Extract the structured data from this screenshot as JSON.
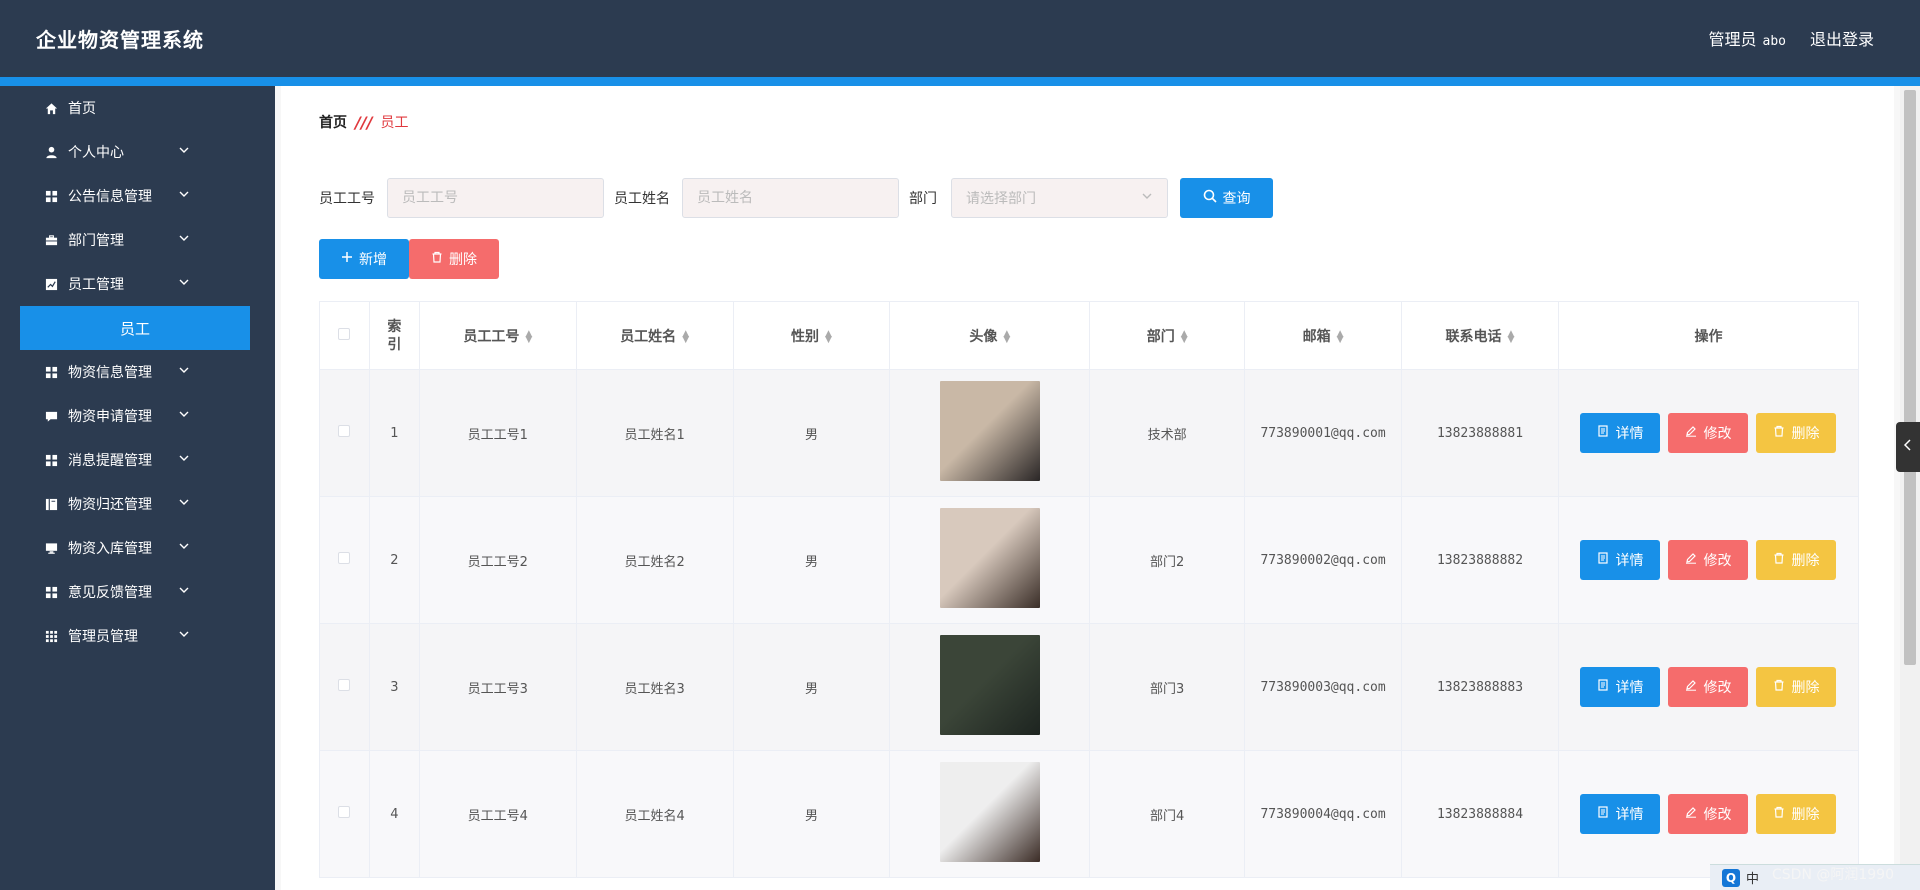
{
  "header": {
    "app_title": "企业物资管理系统",
    "admin_label": "管理员",
    "admin_username": "abo",
    "logout_label": "退出登录"
  },
  "sidebar": {
    "items": [
      {
        "label": "首页",
        "icon": "home-icon",
        "has_children": false
      },
      {
        "label": "个人中心",
        "icon": "user-icon",
        "has_children": true
      },
      {
        "label": "公告信息管理",
        "icon": "grid-icon",
        "has_children": true
      },
      {
        "label": "部门管理",
        "icon": "briefcase-icon",
        "has_children": true
      },
      {
        "label": "员工管理",
        "icon": "chart-icon",
        "has_children": true
      },
      {
        "label": "物资信息管理",
        "icon": "grid-icon",
        "has_children": true
      },
      {
        "label": "物资申请管理",
        "icon": "comment-icon",
        "has_children": true
      },
      {
        "label": "消息提醒管理",
        "icon": "grid-icon",
        "has_children": true
      },
      {
        "label": "物资归还管理",
        "icon": "book-icon",
        "has_children": true
      },
      {
        "label": "物资入库管理",
        "icon": "monitor-icon",
        "has_children": true
      },
      {
        "label": "意见反馈管理",
        "icon": "grid-icon",
        "has_children": true
      },
      {
        "label": "管理员管理",
        "icon": "apps-icon",
        "has_children": true
      }
    ],
    "active_submenu": "员工"
  },
  "breadcrumb": {
    "home": "首页",
    "separator": "///",
    "current": "员工"
  },
  "search": {
    "emp_no_label": "员工工号",
    "emp_no_placeholder": "员工工号",
    "emp_name_label": "员工姓名",
    "emp_name_placeholder": "员工姓名",
    "dept_label": "部门",
    "dept_placeholder": "请选择部门",
    "query_label": "查询"
  },
  "actions": {
    "add_label": "新增",
    "delete_label": "删除"
  },
  "table": {
    "columns": [
      "索引",
      "员工工号",
      "员工姓名",
      "性别",
      "头像",
      "部门",
      "邮箱",
      "联系电话",
      "操作"
    ],
    "rows": [
      {
        "index": "1",
        "emp_no": "员工工号1",
        "name": "员工姓名1",
        "gender": "男",
        "dept": "技术部",
        "email": "773890001@qq.com",
        "phone": "13823888881",
        "avatar_colors": [
          "#c9b8a6",
          "#2a2626"
        ]
      },
      {
        "index": "2",
        "emp_no": "员工工号2",
        "name": "员工姓名2",
        "gender": "男",
        "dept": "部门2",
        "email": "773890002@qq.com",
        "phone": "13823888882",
        "avatar_colors": [
          "#d8c9bd",
          "#3a2e28"
        ]
      },
      {
        "index": "3",
        "emp_no": "员工工号3",
        "name": "员工姓名3",
        "gender": "男",
        "dept": "部门3",
        "email": "773890003@qq.com",
        "phone": "13823888883",
        "avatar_colors": [
          "#3b4538",
          "#1d2420"
        ]
      },
      {
        "index": "4",
        "emp_no": "员工工号4",
        "name": "员工姓名4",
        "gender": "男",
        "dept": "部门4",
        "email": "773890004@qq.com",
        "phone": "13823888884",
        "avatar_colors": [
          "#eeeeee",
          "#3b2c26"
        ]
      }
    ],
    "op_detail": "详情",
    "op_edit": "修改",
    "op_delete": "删除"
  },
  "colors": {
    "sidebar_bg": "#2c3b50",
    "accent_blue": "#1890e8",
    "danger_red": "#f56c6c",
    "warn_yellow": "#f4c542"
  },
  "footer": {
    "ime_char": "中",
    "watermark": "CSDN @阿润1990"
  }
}
